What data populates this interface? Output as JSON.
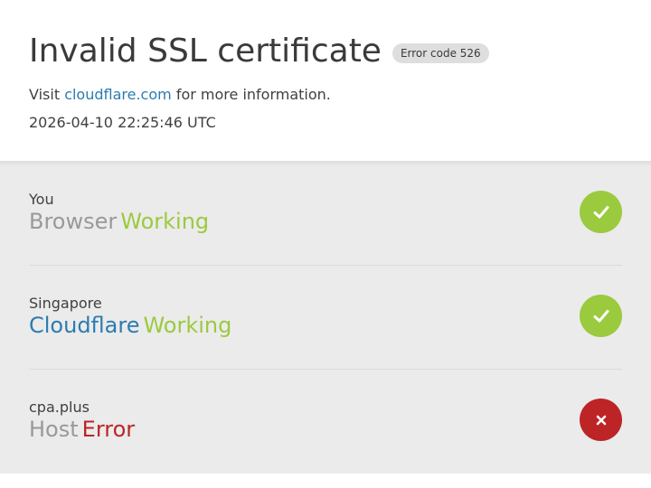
{
  "header": {
    "title": "Invalid SSL certificate",
    "error_badge": "Error code 526",
    "visit_prefix": "Visit",
    "visit_link": "cloudflare.com",
    "visit_suffix": "for more information.",
    "timestamp": "2026-04-10 22:25:46 UTC"
  },
  "status": {
    "rows": [
      {
        "location": "You",
        "name": "Browser",
        "state": "Working",
        "icon": "check-icon"
      },
      {
        "location": "Singapore",
        "name": "Cloudflare",
        "state": "Working",
        "icon": "check-icon"
      },
      {
        "location": "cpa.plus",
        "name": "Host",
        "state": "Error",
        "icon": "cross-icon"
      }
    ]
  },
  "colors": {
    "working": "#9bca3e",
    "error": "#bd2426",
    "link": "#2c7cb0",
    "panel_bg": "#ebebeb"
  }
}
